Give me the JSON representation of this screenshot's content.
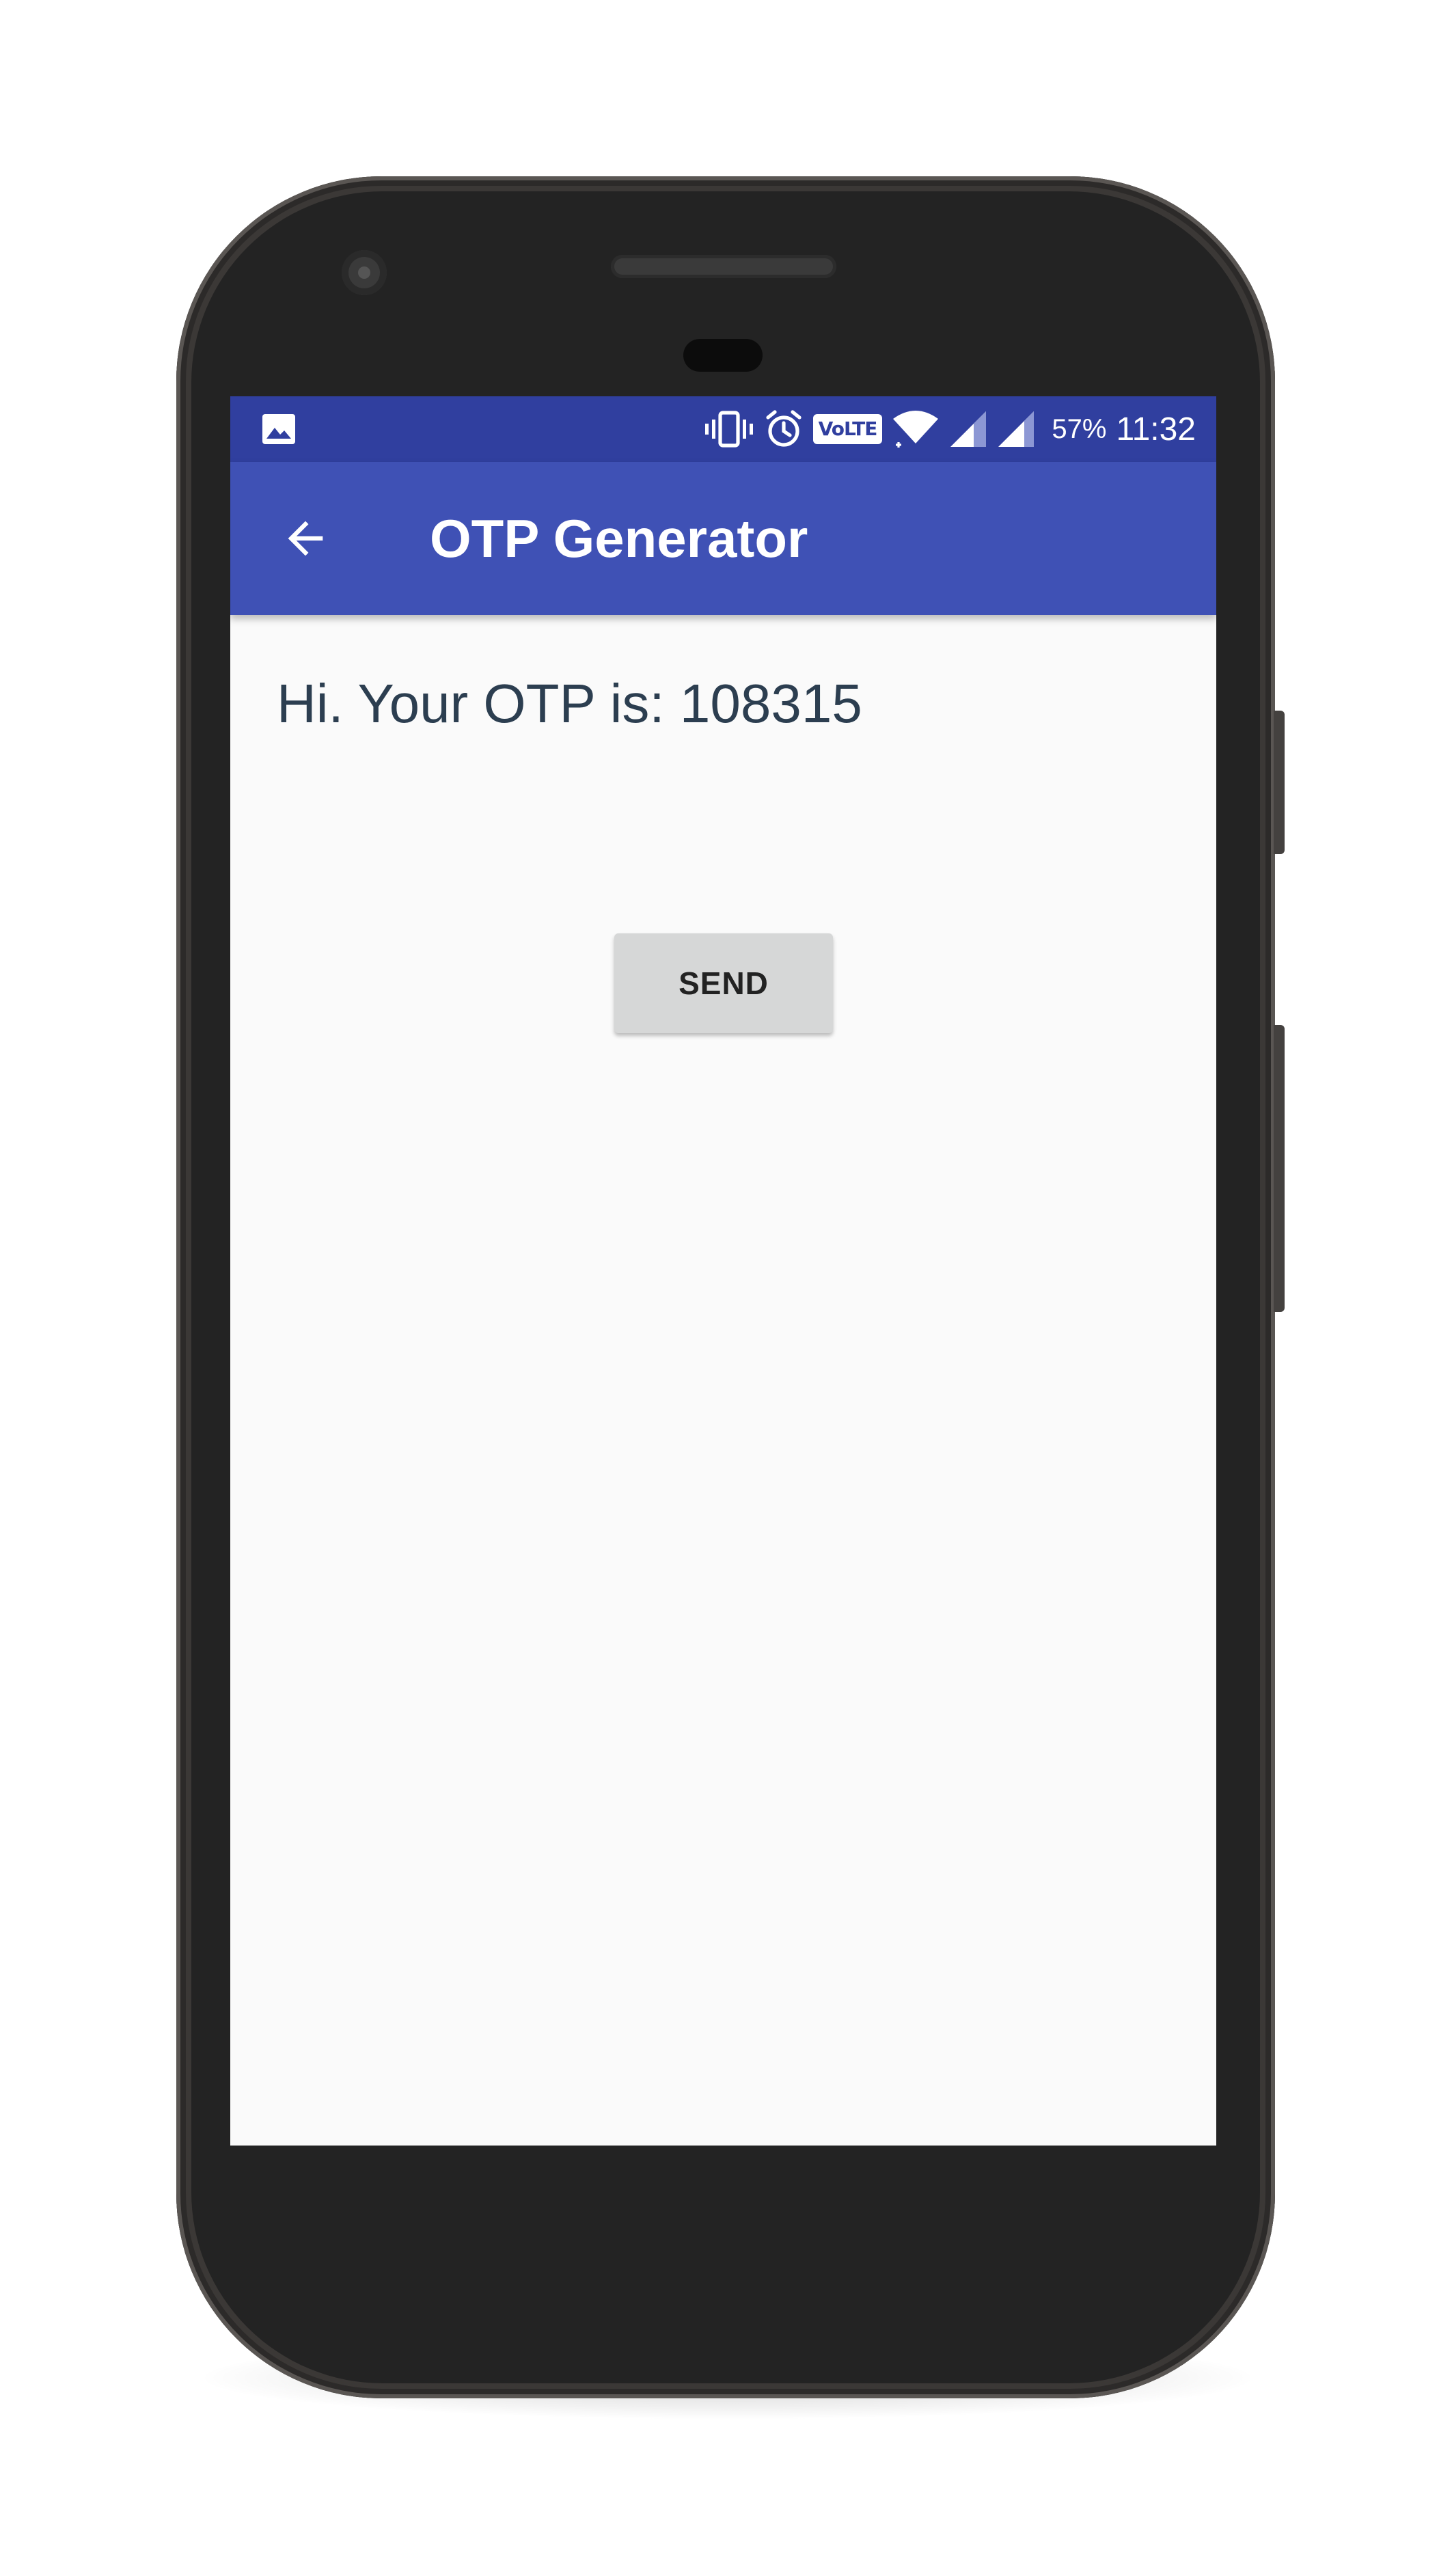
{
  "status_bar": {
    "icons": [
      "image-notification-icon",
      "vibrate-icon",
      "alarm-icon",
      "volte-badge",
      "wifi-icon",
      "signal-icon",
      "signal-icon"
    ],
    "volte_label": "VoLTE",
    "battery": "57%",
    "time": "11:32"
  },
  "app_bar": {
    "back_icon": "arrow-left-icon",
    "title": "OTP Generator"
  },
  "main": {
    "otp_message": "Hi. Your OTP is: 108315",
    "send_label": "SEND"
  },
  "colors": {
    "status_bar": "#303f9f",
    "app_bar": "#3f51b5",
    "background": "#fafafa",
    "button": "#d6d7d7",
    "text": "#2c3e50"
  }
}
